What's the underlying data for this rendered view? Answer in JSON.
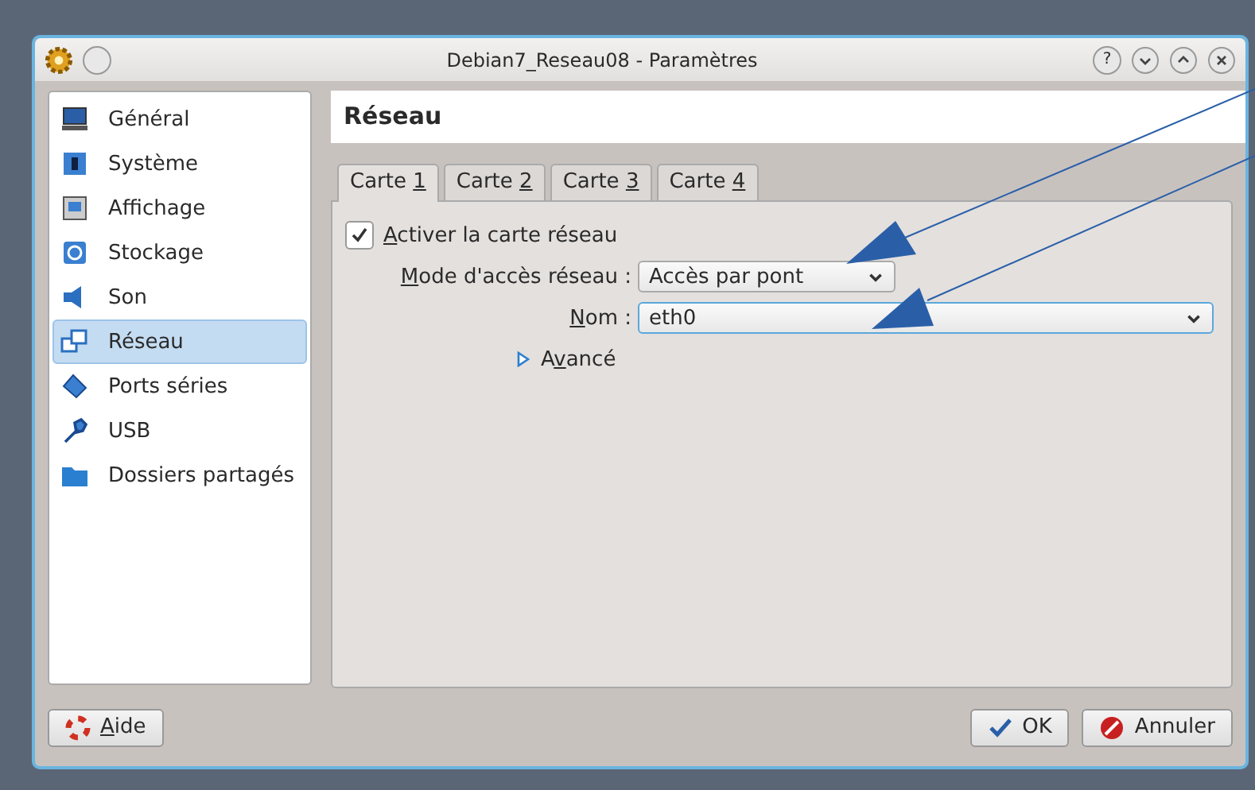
{
  "window": {
    "title": "Debian7_Reseau08 - Paramètres",
    "help_glyph": "?"
  },
  "sidebar": {
    "items": [
      {
        "label": "Général",
        "selected": false
      },
      {
        "label": "Système",
        "selected": false
      },
      {
        "label": "Affichage",
        "selected": false
      },
      {
        "label": "Stockage",
        "selected": false
      },
      {
        "label": "Son",
        "selected": false
      },
      {
        "label": "Réseau",
        "selected": true
      },
      {
        "label": "Ports séries",
        "selected": false
      },
      {
        "label": "USB",
        "selected": false
      },
      {
        "label": "Dossiers partagés",
        "selected": false
      }
    ]
  },
  "page_title": "Réseau",
  "tabs": [
    {
      "before": "Carte ",
      "key": "1",
      "selected": true
    },
    {
      "before": "Carte ",
      "key": "2",
      "selected": false
    },
    {
      "before": "Carte ",
      "key": "3",
      "selected": false
    },
    {
      "before": "Carte ",
      "key": "4",
      "selected": false
    }
  ],
  "enable": {
    "key": "A",
    "after": "ctiver la carte réseau",
    "checked": true
  },
  "mode": {
    "key": "M",
    "after": "ode d'accès réseau :",
    "value": "Accès par pont"
  },
  "name": {
    "key": "N",
    "after": "om :",
    "value": "eth0"
  },
  "advanced": {
    "before": "A",
    "key": "v",
    "after": "ancé",
    "expanded": false
  },
  "buttons": [
    {
      "kind": "help",
      "key": "A",
      "after": "ide"
    },
    {
      "kind": "ok",
      "after": "OK"
    },
    {
      "kind": "cancel",
      "after": "Annuler"
    }
  ]
}
